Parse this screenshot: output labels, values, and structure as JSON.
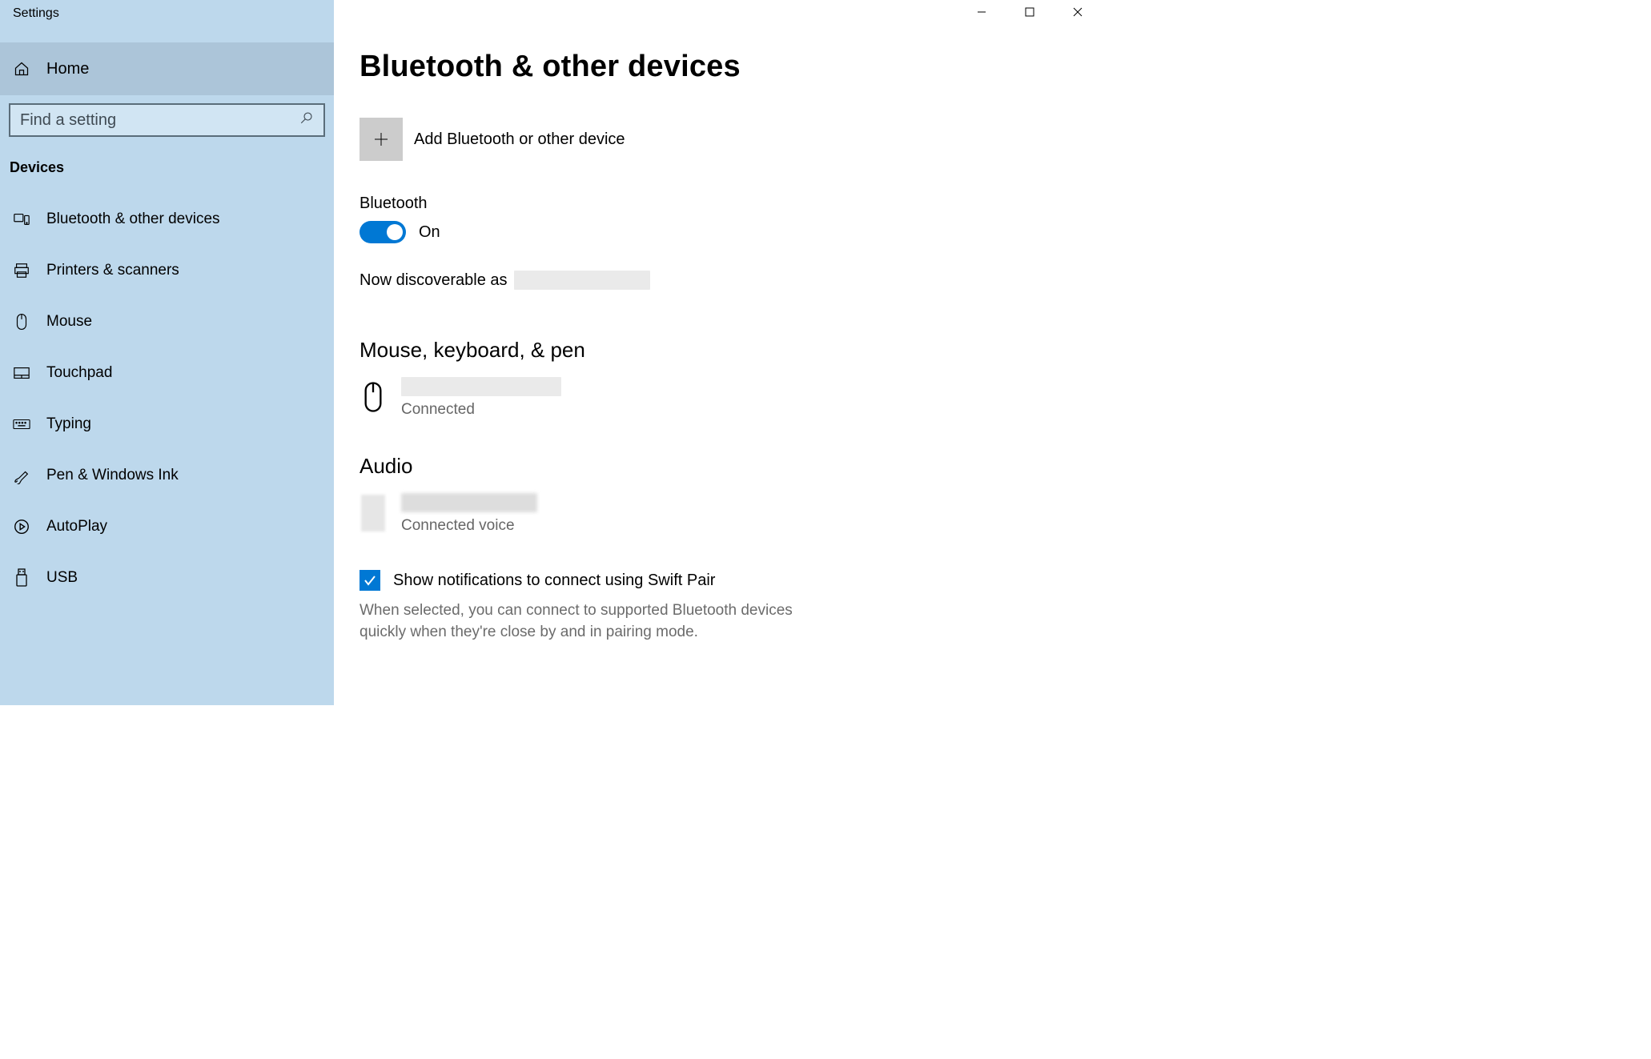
{
  "window": {
    "title": "Settings"
  },
  "sidebar": {
    "home_label": "Home",
    "search_placeholder": "Find a setting",
    "section_label": "Devices",
    "items": [
      {
        "label": "Bluetooth & other devices"
      },
      {
        "label": "Printers & scanners"
      },
      {
        "label": "Mouse"
      },
      {
        "label": "Touchpad"
      },
      {
        "label": "Typing"
      },
      {
        "label": "Pen & Windows Ink"
      },
      {
        "label": "AutoPlay"
      },
      {
        "label": "USB"
      }
    ]
  },
  "page": {
    "heading": "Bluetooth & other devices",
    "add_device_label": "Add Bluetooth or other device",
    "bluetooth_heading": "Bluetooth",
    "bluetooth_state": "On",
    "discoverable_prefix": "Now discoverable as",
    "group_mouse_heading": "Mouse, keyboard, & pen",
    "mouse_device_status": "Connected",
    "group_audio_heading": "Audio",
    "audio_device_status": "Connected voice",
    "swift_pair_label": "Show notifications to connect using Swift Pair",
    "swift_pair_desc": "When selected, you can connect to supported Bluetooth devices quickly when they're close by and in pairing mode."
  }
}
